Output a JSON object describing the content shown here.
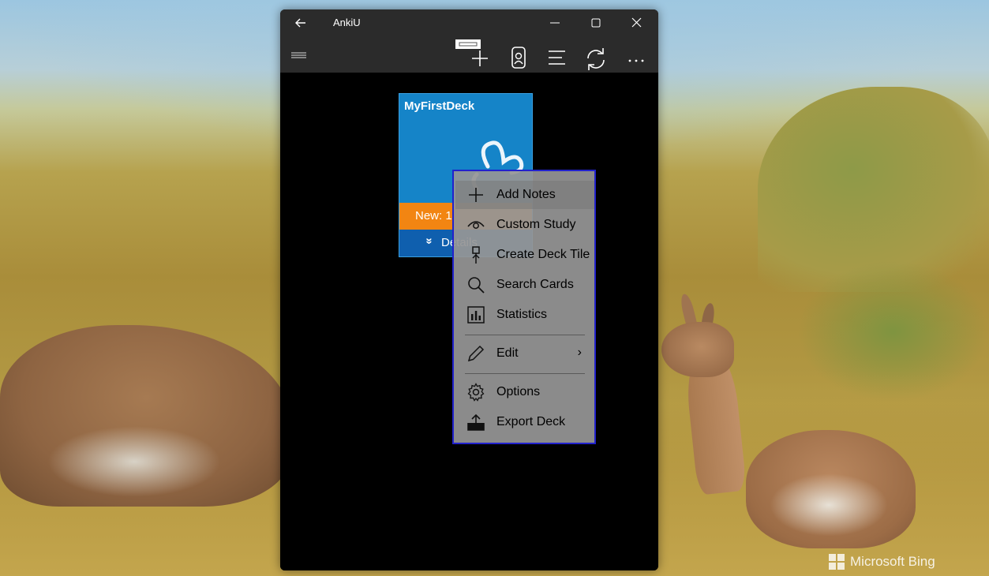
{
  "window": {
    "title": "AnkiU"
  },
  "titlebar_controls": {
    "back": "back-icon",
    "minimize": "minimize-icon",
    "maximize": "maximize-icon",
    "close": "close-icon"
  },
  "toolbar": {
    "menu": "hamburger-icon",
    "add": "add-note-icon",
    "image": "image-note-icon",
    "list": "list-icon",
    "sync": "sync-icon",
    "more": "more-icon",
    "more_label": "···"
  },
  "deck": {
    "name": "MyFirstDeck",
    "new_label": "New: 1",
    "details_chevron": "»",
    "details_label": "Details",
    "tile_color": "#1584c8",
    "new_color": "#f28512",
    "details_color": "#0f5fae"
  },
  "context_menu": {
    "items": [
      {
        "label": "Add Notes",
        "icon": "plus-icon"
      },
      {
        "label": "Custom Study",
        "icon": "eye-icon"
      },
      {
        "label": "Create Deck Tile",
        "icon": "pin-icon"
      },
      {
        "label": "Search Cards",
        "icon": "search-icon"
      },
      {
        "label": "Statistics",
        "icon": "statistics-icon"
      },
      {
        "label": "Edit",
        "icon": "pencil-icon",
        "submenu_arrow": "›"
      },
      {
        "label": "Options",
        "icon": "gear-icon"
      },
      {
        "label": "Export Deck",
        "icon": "export-icon"
      }
    ],
    "border_color": "#2222cc"
  },
  "watermark": {
    "text": "Microsoft Bing"
  }
}
